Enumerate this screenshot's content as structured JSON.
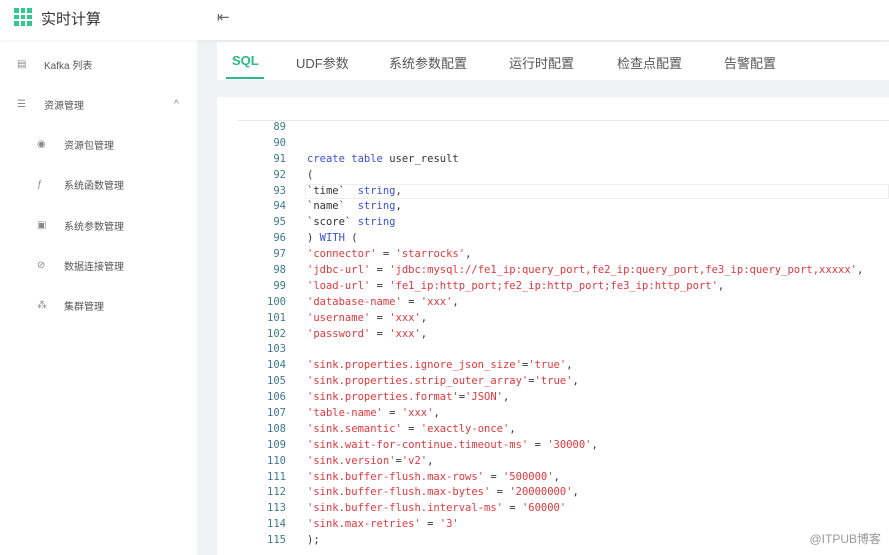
{
  "header": {
    "app_title": "实时计算",
    "logo_icon": "grid-icon",
    "collapse_icon": "menu-fold-icon"
  },
  "sidebar": {
    "items": [
      {
        "label": "Kafka 列表",
        "icon": "list-icon"
      },
      {
        "label": "资源管理",
        "icon": "menu-icon",
        "expanded": true
      },
      {
        "label": "资源包管理",
        "icon": "play-circle-icon"
      },
      {
        "label": "系统函数管理",
        "icon": "function-icon"
      },
      {
        "label": "系统参数管理",
        "icon": "file-icon"
      },
      {
        "label": "数据连接管理",
        "icon": "check-circle-icon"
      },
      {
        "label": "集群管理",
        "icon": "cluster-icon"
      }
    ]
  },
  "tabs": [
    "SQL",
    "UDF参数",
    "系统参数配置",
    "运行时配置",
    "检查点配置",
    "告警配置"
  ],
  "active_tab": "SQL",
  "accent": "#2bb985",
  "editor": {
    "lines": [
      {
        "n": "89",
        "seg": []
      },
      {
        "n": "90",
        "seg": []
      },
      {
        "n": "91",
        "seg": [
          [
            "k",
            "create table "
          ],
          [
            "p",
            "user_result"
          ]
        ]
      },
      {
        "n": "92",
        "seg": [
          [
            "p",
            "("
          ]
        ]
      },
      {
        "n": "93",
        "seg": [
          [
            "p",
            "`time`  "
          ],
          [
            "k",
            "string"
          ],
          [
            "p",
            ","
          ]
        ]
      },
      {
        "n": "94",
        "seg": [
          [
            "p",
            "`name`  "
          ],
          [
            "k",
            "string"
          ],
          [
            "p",
            ","
          ]
        ]
      },
      {
        "n": "95",
        "seg": [
          [
            "p",
            "`score` "
          ],
          [
            "k",
            "string"
          ]
        ]
      },
      {
        "n": "96",
        "seg": [
          [
            "p",
            ") "
          ],
          [
            "k",
            "WITH"
          ],
          [
            "p",
            " ("
          ]
        ]
      },
      {
        "n": "97",
        "seg": [
          [
            "s",
            "'connector'"
          ],
          [
            "p",
            " = "
          ],
          [
            "s",
            "'starrocks'"
          ],
          [
            "p",
            ","
          ]
        ]
      },
      {
        "n": "98",
        "seg": [
          [
            "s",
            "'jdbc-url'"
          ],
          [
            "p",
            " = "
          ],
          [
            "s",
            "'jdbc:mysql://fe1_ip:query_port,fe2_ip:query_port,fe3_ip:query_port,xxxxx'"
          ],
          [
            "p",
            ","
          ]
        ]
      },
      {
        "n": "99",
        "seg": [
          [
            "s",
            "'load-url'"
          ],
          [
            "p",
            " = "
          ],
          [
            "s",
            "'fe1_ip:http_port;fe2_ip:http_port;fe3_ip:http_port'"
          ],
          [
            "p",
            ","
          ]
        ]
      },
      {
        "n": "100",
        "seg": [
          [
            "s",
            "'database-name'"
          ],
          [
            "p",
            " = "
          ],
          [
            "s",
            "'xxx'"
          ],
          [
            "p",
            ","
          ]
        ]
      },
      {
        "n": "101",
        "seg": [
          [
            "s",
            "'username'"
          ],
          [
            "p",
            " = "
          ],
          [
            "s",
            "'xxx'"
          ],
          [
            "p",
            ","
          ]
        ]
      },
      {
        "n": "102",
        "seg": [
          [
            "s",
            "'password'"
          ],
          [
            "p",
            " = "
          ],
          [
            "s",
            "'xxx'"
          ],
          [
            "p",
            ","
          ]
        ]
      },
      {
        "n": "103",
        "seg": []
      },
      {
        "n": "104",
        "seg": [
          [
            "s",
            "'sink.properties.ignore_json_size'"
          ],
          [
            "p",
            "="
          ],
          [
            "s",
            "'true'"
          ],
          [
            "p",
            ","
          ]
        ]
      },
      {
        "n": "105",
        "seg": [
          [
            "s",
            "'sink.properties.strip_outer_array'"
          ],
          [
            "p",
            "="
          ],
          [
            "s",
            "'true'"
          ],
          [
            "p",
            ","
          ]
        ]
      },
      {
        "n": "106",
        "seg": [
          [
            "s",
            "'sink.properties.format'"
          ],
          [
            "p",
            "="
          ],
          [
            "s",
            "'JSON'"
          ],
          [
            "p",
            ","
          ]
        ]
      },
      {
        "n": "107",
        "seg": [
          [
            "s",
            "'table-name'"
          ],
          [
            "p",
            " = "
          ],
          [
            "s",
            "'xxx'"
          ],
          [
            "p",
            ","
          ]
        ]
      },
      {
        "n": "108",
        "seg": [
          [
            "s",
            "'sink.semantic'"
          ],
          [
            "p",
            " = "
          ],
          [
            "s",
            "'exactly-once'"
          ],
          [
            "p",
            ","
          ]
        ]
      },
      {
        "n": "109",
        "seg": [
          [
            "s",
            "'sink.wait-for-continue.timeout-ms'"
          ],
          [
            "p",
            " = "
          ],
          [
            "s",
            "'30000'"
          ],
          [
            "p",
            ","
          ]
        ]
      },
      {
        "n": "110",
        "seg": [
          [
            "s",
            "'sink.version'"
          ],
          [
            "p",
            "="
          ],
          [
            "s",
            "'v2'"
          ],
          [
            "p",
            ","
          ]
        ]
      },
      {
        "n": "111",
        "seg": [
          [
            "s",
            "'sink.buffer-flush.max-rows'"
          ],
          [
            "p",
            " = "
          ],
          [
            "s",
            "'500000'"
          ],
          [
            "p",
            ","
          ]
        ]
      },
      {
        "n": "112",
        "seg": [
          [
            "s",
            "'sink.buffer-flush.max-bytes'"
          ],
          [
            "p",
            " = "
          ],
          [
            "s",
            "'20000000'"
          ],
          [
            "p",
            ","
          ]
        ]
      },
      {
        "n": "113",
        "seg": [
          [
            "s",
            "'sink.buffer-flush.interval-ms'"
          ],
          [
            "p",
            " = "
          ],
          [
            "s",
            "'60000'"
          ]
        ]
      },
      {
        "n": "114",
        "seg": [
          [
            "s",
            "'sink.max-retries'"
          ],
          [
            "p",
            " = "
          ],
          [
            "s",
            "'3'"
          ]
        ]
      },
      {
        "n": "115",
        "seg": [
          [
            "p",
            ");"
          ]
        ]
      }
    ]
  },
  "watermark": "@ITPUB博客"
}
